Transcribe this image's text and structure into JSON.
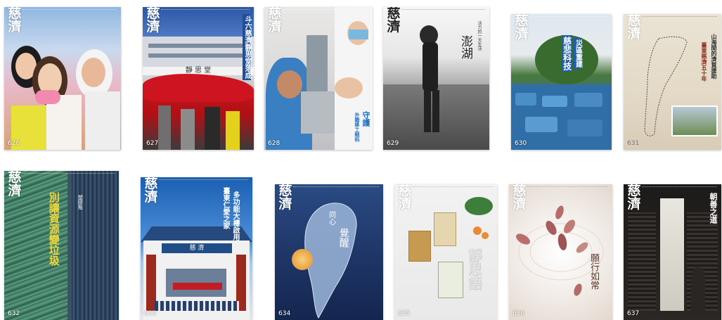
{
  "logo": "慈濟",
  "covers": [
    {
      "issue": "626",
      "headline": "",
      "subline": ""
    },
    {
      "issue": "627",
      "headline": "斗六慈濟靜思堂落成",
      "subline": ""
    },
    {
      "issue": "628",
      "headline": "守護",
      "subline": "外籍移工眼科"
    },
    {
      "issue": "629",
      "headline": "澎湖",
      "subline": "活力的一天生活"
    },
    {
      "issue": "630",
      "headline": "慈悲科技",
      "subline": "災區重建"
    },
    {
      "issue": "631",
      "headline": "山海間的濟貧援助",
      "subline": "臺東慈濟五十年"
    },
    {
      "issue": "632",
      "headline": "別讓資源變垃圾",
      "subline": "塑膠瓶"
    },
    {
      "issue": "633",
      "headline": "臺東仁愛之家",
      "subline": "多功能大樓啟用"
    },
    {
      "issue": "634",
      "headline": "覺醒",
      "subline": "同心"
    },
    {
      "issue": "635",
      "headline": "靜思語",
      "subline": ""
    },
    {
      "issue": "636",
      "headline": "願行如常",
      "subline": ""
    },
    {
      "issue": "637",
      "headline": "朝善之道",
      "subline": ""
    }
  ]
}
